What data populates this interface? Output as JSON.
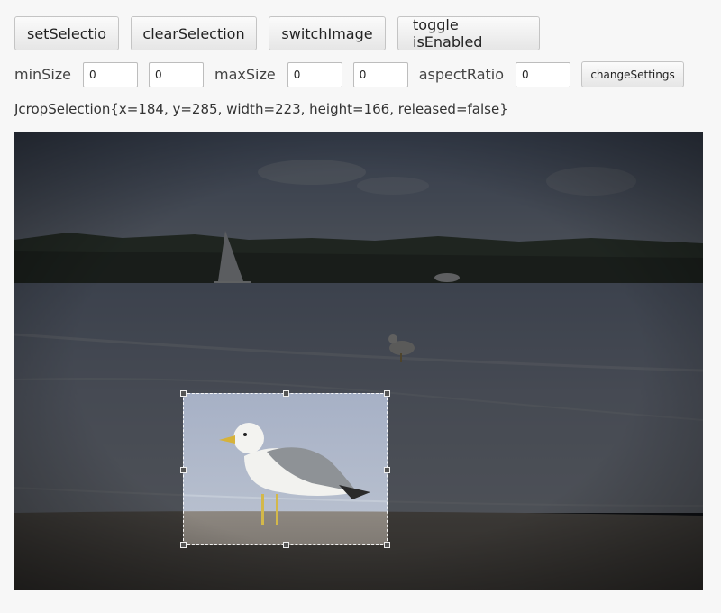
{
  "buttons": {
    "set_selection": "setSelectio",
    "clear_selection": "clearSelection",
    "switch_image": "switchImage",
    "toggle_enabled": "toggle isEnabled",
    "change_settings": "changeSettings"
  },
  "settings": {
    "min_size_label": "minSize",
    "min_size_w": "0",
    "min_size_h": "0",
    "max_size_label": "maxSize",
    "max_size_w": "0",
    "max_size_h": "0",
    "aspect_ratio_label": "aspectRatio",
    "aspect_ratio": "0"
  },
  "status": {
    "text": "JcropSelection{x=184, y=285, width=223, height=166, released=false}"
  },
  "icons": [
    "selection-handle-icon"
  ]
}
